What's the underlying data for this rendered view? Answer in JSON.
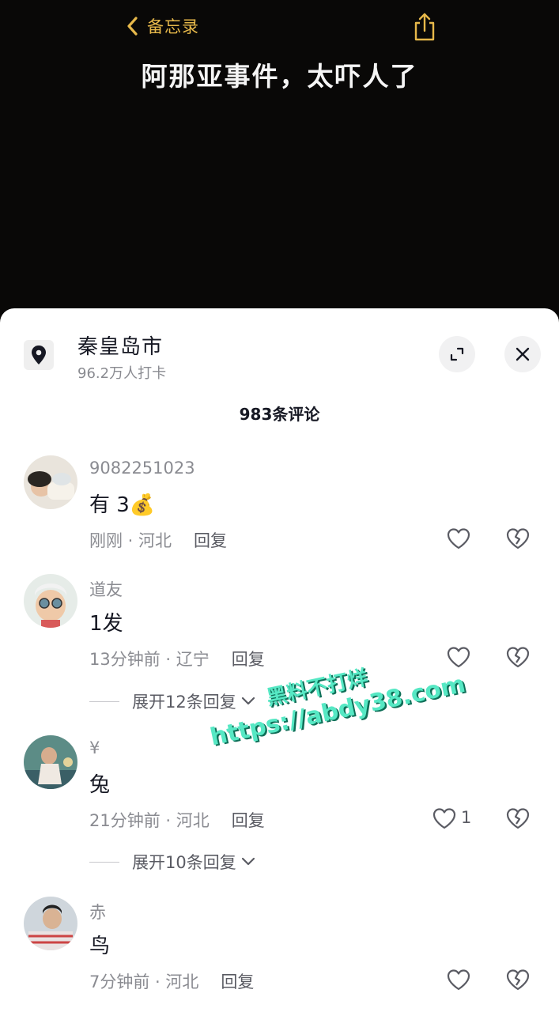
{
  "header": {
    "back_label": "备忘录",
    "title": "阿那亚事件，太吓人了"
  },
  "location": {
    "name": "秦皇岛市",
    "checkins": "96.2万人打卡"
  },
  "comments_header": {
    "count_label": "983条评论"
  },
  "comments": [
    {
      "username": "9082251023",
      "text": "有 3💰",
      "time": "刚刚",
      "region": "河北",
      "reply_label": "回复",
      "likes": ""
    },
    {
      "username": "道友",
      "text": "1发",
      "time": "13分钟前",
      "region": "辽宁",
      "reply_label": "回复",
      "likes": "",
      "expand_label": "展开12条回复"
    },
    {
      "username": "¥",
      "text": "兔",
      "time": "21分钟前",
      "region": "河北",
      "reply_label": "回复",
      "likes": "1",
      "expand_label": "展开10条回复"
    },
    {
      "username": "赤",
      "text": "鸟",
      "time": "7分钟前",
      "region": "河北",
      "reply_label": "回复",
      "likes": ""
    }
  ],
  "watermark": {
    "line1": "黑料不打烊",
    "line2": "https://abdy38.com"
  },
  "colors": {
    "accent_gold": "#e6b84a",
    "watermark_teal": "#56e8c4",
    "text_primary": "#161823",
    "text_secondary": "#8a8b91"
  }
}
